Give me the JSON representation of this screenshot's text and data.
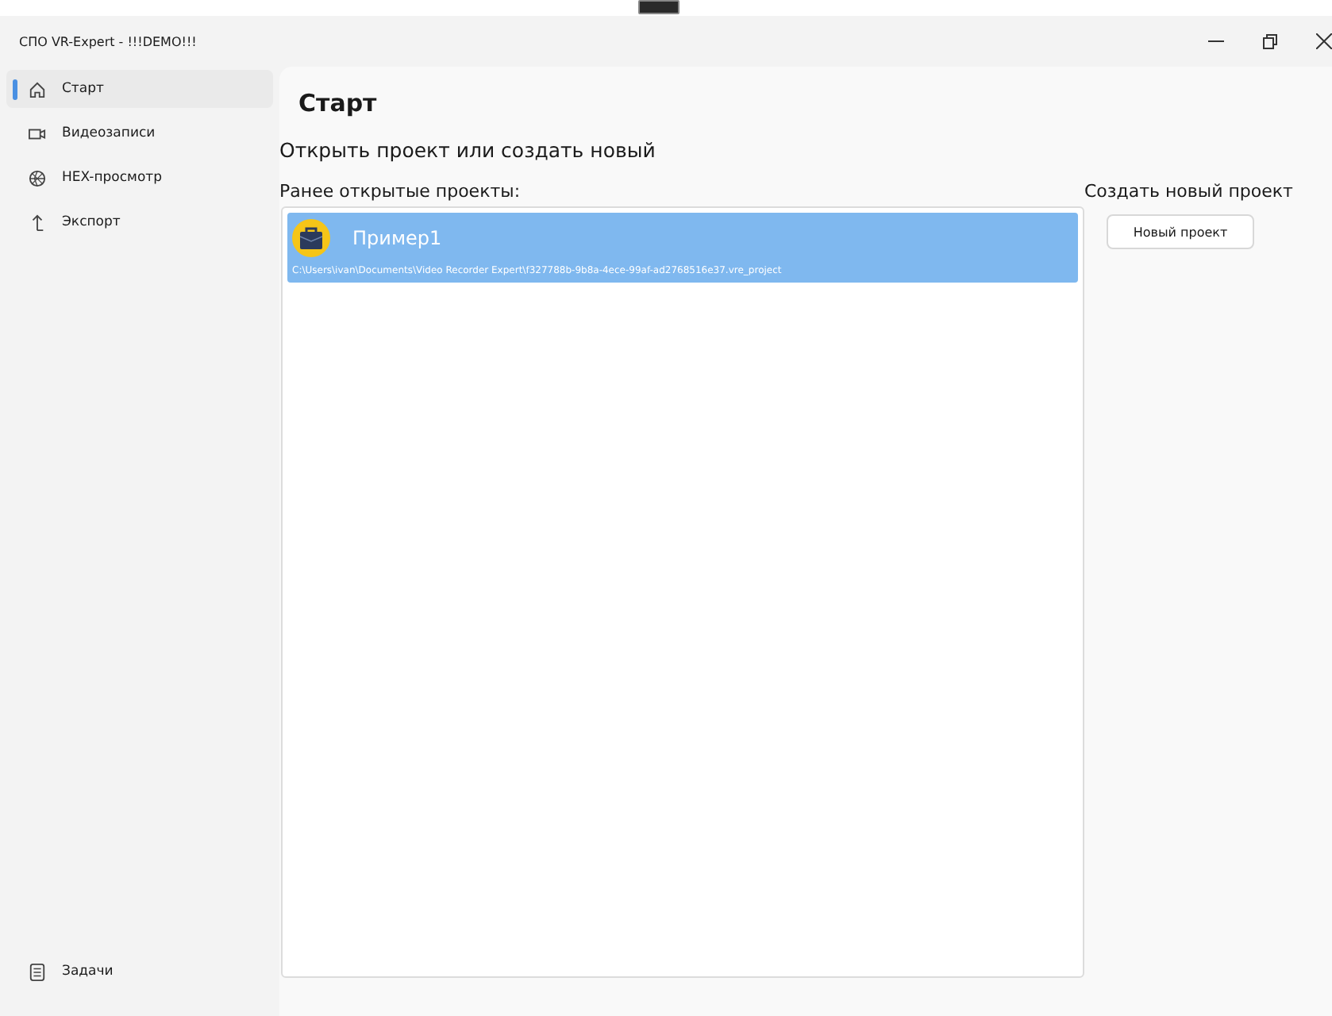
{
  "window": {
    "title": "СПО VR-Expert - !!!DEMO!!!"
  },
  "sidebar": {
    "items": [
      {
        "label": "Старт",
        "selected": true
      },
      {
        "label": "Видеозаписи",
        "selected": false
      },
      {
        "label": "HEX-просмотр",
        "selected": false
      },
      {
        "label": "Экспорт",
        "selected": false
      }
    ],
    "bottom_items": [
      {
        "label": "Задачи",
        "selected": false
      }
    ]
  },
  "page": {
    "title": "Старт",
    "subtitle": "Открыть проект или создать новый",
    "recent": {
      "label": "Ранее открытые проекты:",
      "projects": [
        {
          "name": "Пример1",
          "path": "C:\\Users\\ivan\\Documents\\Video Recorder Expert\\f327788b-9b8a-4ece-99af-ad2768516e37.vre_project",
          "selected": true
        }
      ]
    },
    "create": {
      "label": "Создать новый проект",
      "button": "Новый проект"
    }
  }
}
